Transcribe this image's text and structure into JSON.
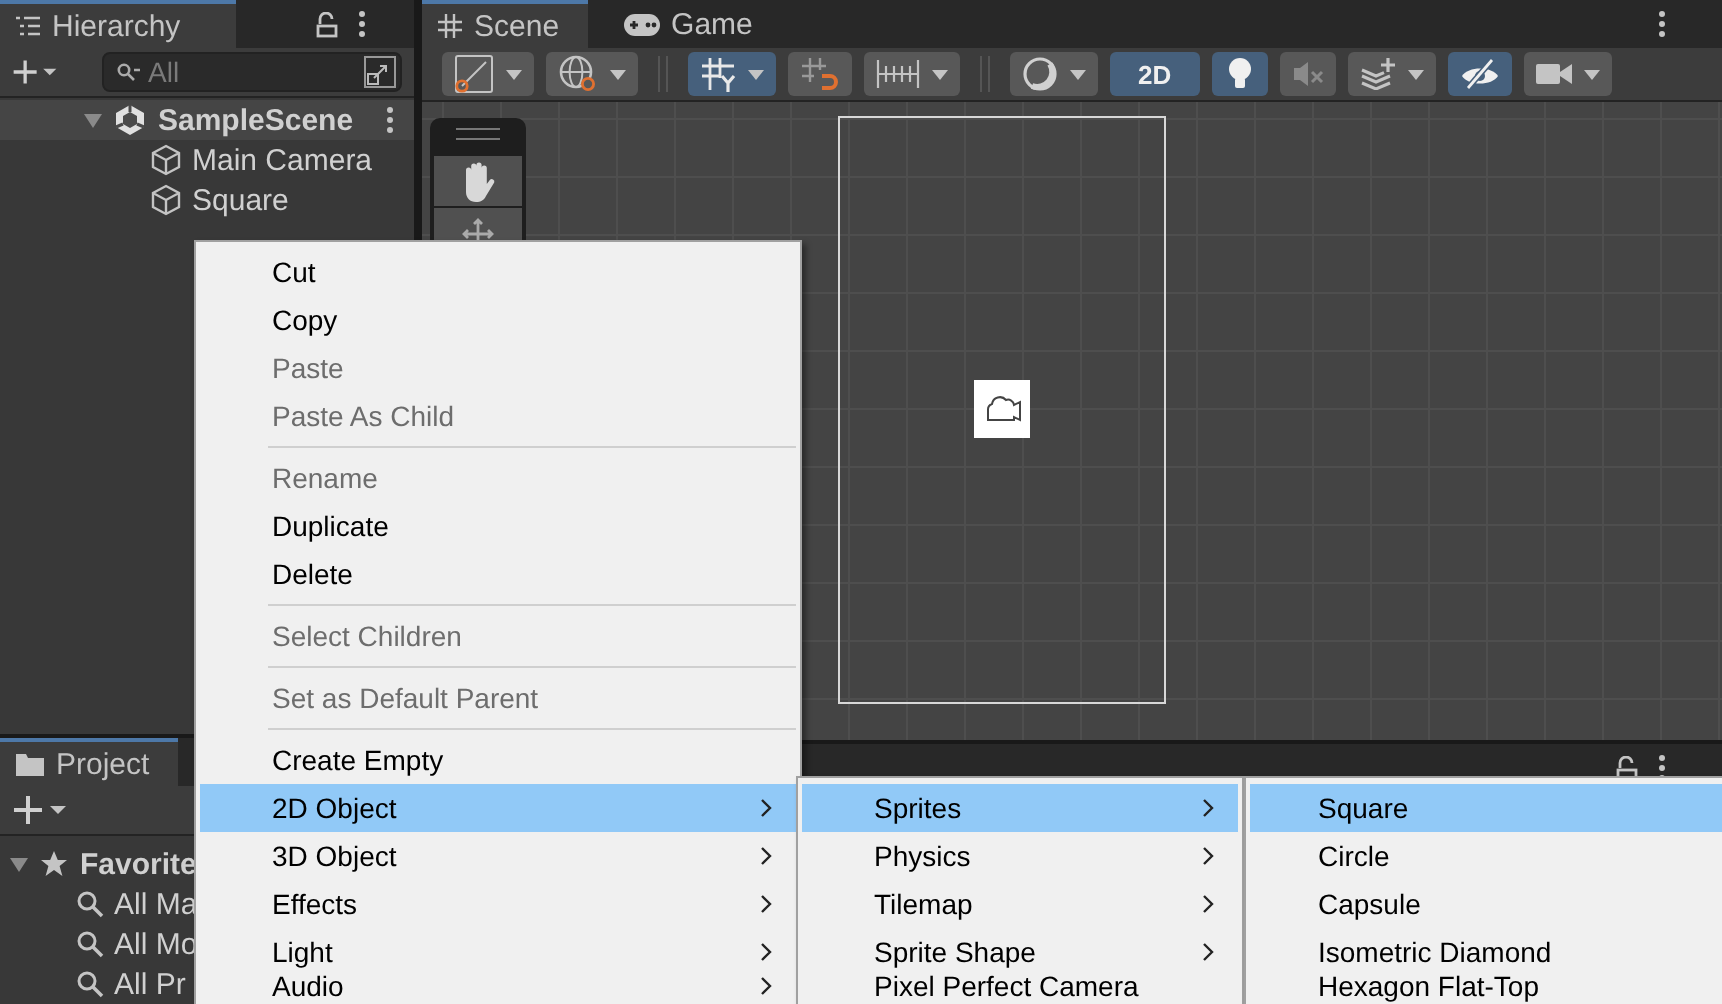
{
  "hierarchy": {
    "title": "Hierarchy",
    "search": {
      "placeholder": "All"
    },
    "scene": {
      "name": "SampleScene",
      "expanded": true
    },
    "objects": [
      "Main Camera",
      "Square"
    ]
  },
  "scene_tabs": [
    {
      "label": "Scene",
      "selected": true
    },
    {
      "label": "Game",
      "selected": false
    }
  ],
  "scene_toolbar": [
    {
      "kind": "draw-mode",
      "on": false,
      "dropdown": true
    },
    {
      "kind": "globe",
      "on": false,
      "dropdown": true
    },
    {
      "kind": "separator"
    },
    {
      "kind": "grid-snap",
      "on": true,
      "dropdown": true
    },
    {
      "kind": "increment-snap",
      "on": false,
      "dropdown": false
    },
    {
      "kind": "ruler",
      "on": false,
      "dropdown": true
    },
    {
      "kind": "separator"
    },
    {
      "kind": "shading",
      "on": false,
      "dropdown": true
    },
    {
      "kind": "text",
      "label": "2D",
      "on": true,
      "dropdown": false
    },
    {
      "kind": "light",
      "on": true,
      "dropdown": false
    },
    {
      "kind": "audio",
      "on": false,
      "dropdown": false
    },
    {
      "kind": "effects",
      "on": false,
      "dropdown": true
    },
    {
      "kind": "visibility",
      "on": true,
      "dropdown": false
    },
    {
      "kind": "camera",
      "on": false,
      "dropdown": true
    }
  ],
  "project": {
    "title": "Project",
    "favorites": {
      "label": "Favorite",
      "expanded": true
    },
    "items": [
      "All Ma",
      "All Mo",
      "All Pr"
    ]
  },
  "context_menu": [
    {
      "kind": "item",
      "label": "Cut",
      "disabled": false,
      "selected": false,
      "submenu": false
    },
    {
      "kind": "item",
      "label": "Copy",
      "disabled": false,
      "selected": false,
      "submenu": false
    },
    {
      "kind": "item",
      "label": "Paste",
      "disabled": true,
      "selected": false,
      "submenu": false
    },
    {
      "kind": "item",
      "label": "Paste As Child",
      "disabled": true,
      "selected": false,
      "submenu": false
    },
    {
      "kind": "separator"
    },
    {
      "kind": "item",
      "label": "Rename",
      "disabled": true,
      "selected": false,
      "submenu": false
    },
    {
      "kind": "item",
      "label": "Duplicate",
      "disabled": false,
      "selected": false,
      "submenu": false
    },
    {
      "kind": "item",
      "label": "Delete",
      "disabled": false,
      "selected": false,
      "submenu": false
    },
    {
      "kind": "separator"
    },
    {
      "kind": "item",
      "label": "Select Children",
      "disabled": true,
      "selected": false,
      "submenu": false
    },
    {
      "kind": "separator"
    },
    {
      "kind": "item",
      "label": "Set as Default Parent",
      "disabled": true,
      "selected": false,
      "submenu": false
    },
    {
      "kind": "separator"
    },
    {
      "kind": "item",
      "label": "Create Empty",
      "disabled": false,
      "selected": false,
      "submenu": false
    },
    {
      "kind": "item",
      "label": "2D Object",
      "disabled": false,
      "selected": true,
      "submenu": true
    },
    {
      "kind": "item",
      "label": "3D Object",
      "disabled": false,
      "selected": false,
      "submenu": true
    },
    {
      "kind": "item",
      "label": "Effects",
      "disabled": false,
      "selected": false,
      "submenu": true
    },
    {
      "kind": "item",
      "label": "Light",
      "disabled": false,
      "selected": false,
      "submenu": true
    },
    {
      "kind": "item",
      "label": "Audio",
      "disabled": false,
      "selected": false,
      "submenu": true
    }
  ],
  "submenu_2d_object": [
    {
      "label": "Sprites",
      "selected": true,
      "submenu": true
    },
    {
      "label": "Physics",
      "selected": false,
      "submenu": true
    },
    {
      "label": "Tilemap",
      "selected": false,
      "submenu": true
    },
    {
      "label": "Sprite Shape",
      "selected": false,
      "submenu": true
    },
    {
      "label": "Pixel Perfect Camera",
      "selected": false,
      "submenu": false
    }
  ],
  "submenu_sprites": [
    {
      "label": "Square",
      "selected": true
    },
    {
      "label": "Circle",
      "selected": false
    },
    {
      "label": "Capsule",
      "selected": false
    },
    {
      "label": "Isometric Diamond",
      "selected": false
    },
    {
      "label": "Hexagon Flat-Top",
      "selected": false
    }
  ]
}
